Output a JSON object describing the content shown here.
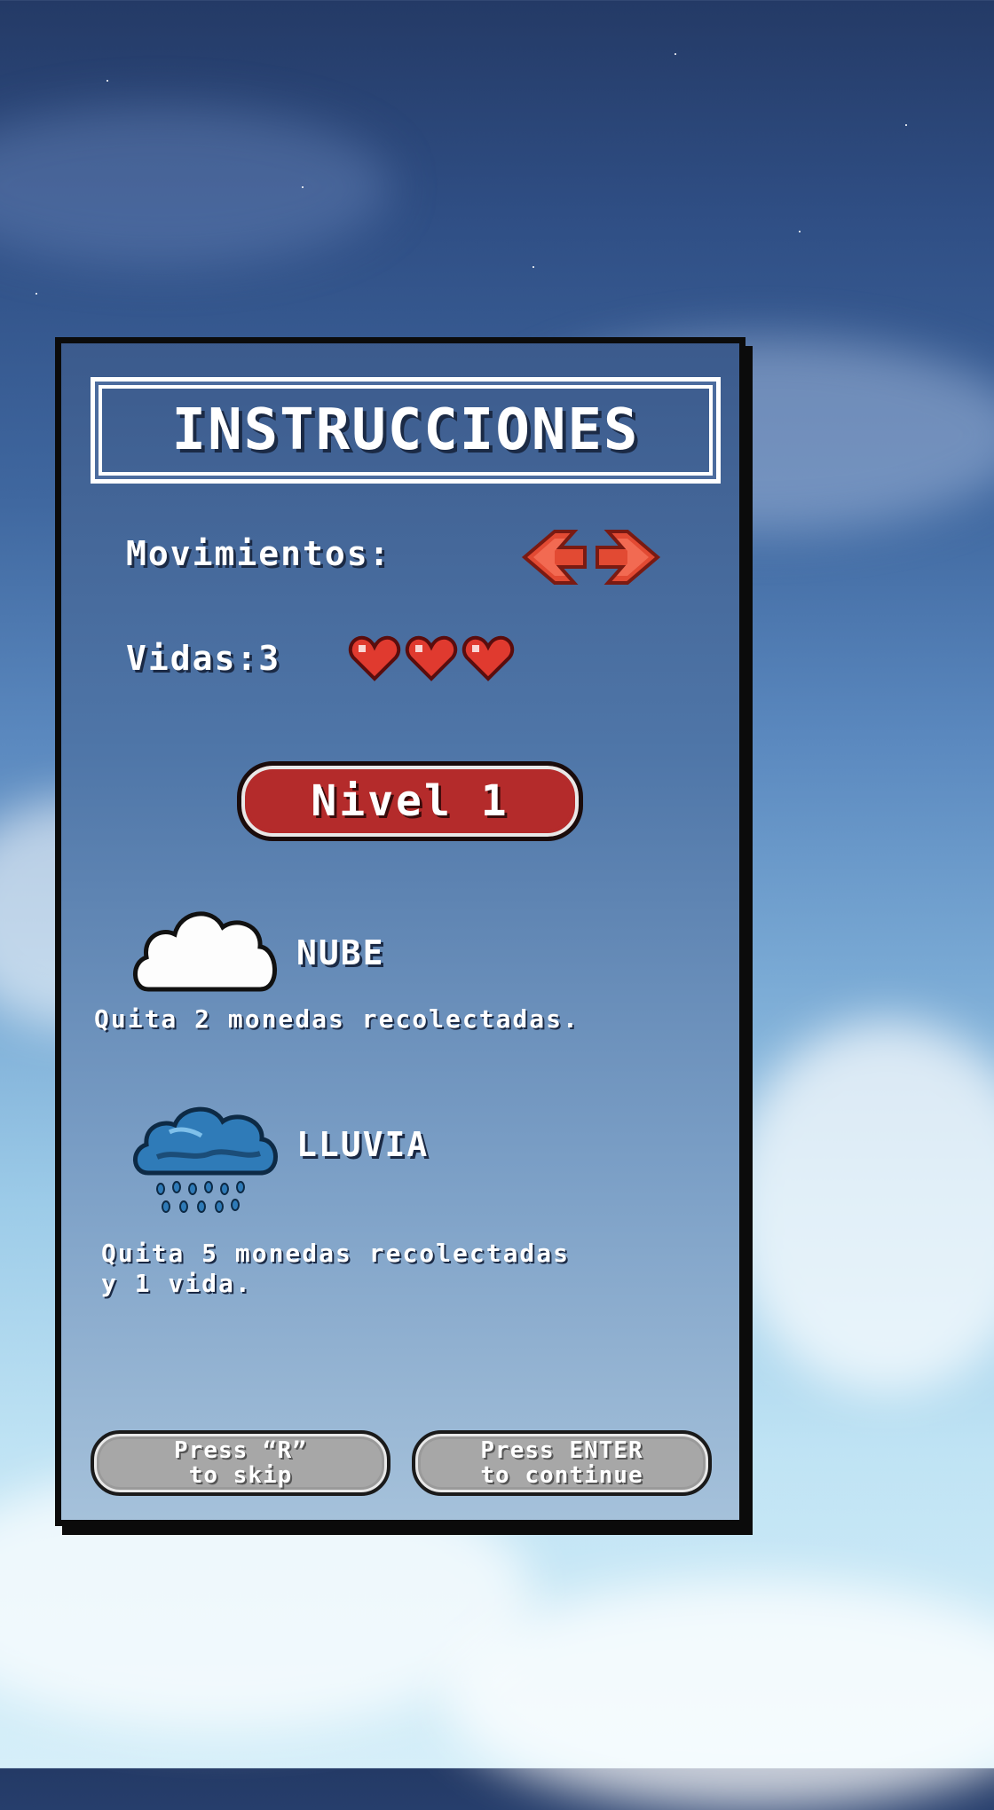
{
  "title": "INSTRUCCIONES",
  "movimientos": {
    "label": "Movimientos:",
    "icons": [
      "arrow-left-icon",
      "arrow-right-icon"
    ]
  },
  "vidas": {
    "label": "Vidas:3",
    "count": 3,
    "icons": [
      "heart-icon",
      "heart-icon",
      "heart-icon"
    ]
  },
  "level": {
    "label": "Nivel 1"
  },
  "enemies": [
    {
      "name": "NUBE",
      "icon": "cloud-icon",
      "description": "Quita 2 monedas recolectadas."
    },
    {
      "name": "LLUVIA",
      "icon": "rain-cloud-icon",
      "description_line1": "Quita 5 monedas recolectadas",
      "description_line2": "y 1 vida."
    }
  ],
  "buttons": {
    "skip": {
      "line1": "Press “R”",
      "line2": "to skip"
    },
    "continue": {
      "line1": "Press ENTER",
      "line2": "to continue"
    }
  },
  "colors": {
    "accent_red": "#b42b2b",
    "heart_red": "#e03a2f",
    "panel_blue": "#4f76a8",
    "button_gray": "#a7a7a7"
  }
}
